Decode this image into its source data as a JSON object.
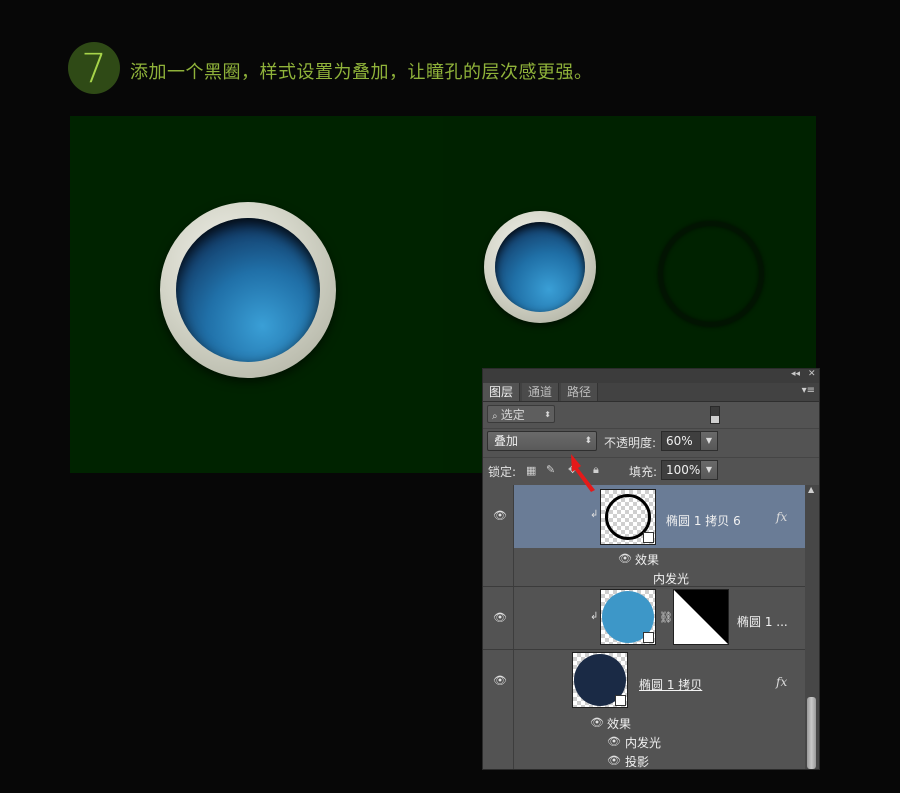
{
  "step": {
    "number": "7",
    "text": "添加一个黑圈，样式设置为叠加，让瞳孔的层次感更强。"
  },
  "colors": {
    "page_bg": "#070707",
    "canvas_bg": "#002300",
    "accent_text": "#8fb23a",
    "panel_bg": "#535353",
    "selected_layer": "#6a7c96",
    "pupil_blue": "#2c86c0",
    "arrow_red": "#e51a1a"
  },
  "panel": {
    "collapse_label": "◂◂",
    "close_label": "✕",
    "tabs": [
      {
        "label": "图层"
      },
      {
        "label": "通道"
      },
      {
        "label": "路径"
      }
    ],
    "menu_icon": "panel-menu-icon",
    "filter_label": "选定",
    "blend_mode": "叠加",
    "opacity_label": "不透明度:",
    "opacity_value": "60%",
    "lock_label": "锁定:",
    "fill_label": "填充:",
    "fill_value": "100%",
    "layers": [
      {
        "name": "椭圆 1 拷贝 6",
        "fx": "fx",
        "effects_label": "效果",
        "effects": [
          "内发光"
        ]
      },
      {
        "name": "椭圆 1 ..."
      },
      {
        "name": "椭圆 1 拷贝",
        "fx": "fx",
        "effects_label": "效果",
        "effects": [
          "内发光",
          "投影"
        ]
      }
    ]
  }
}
